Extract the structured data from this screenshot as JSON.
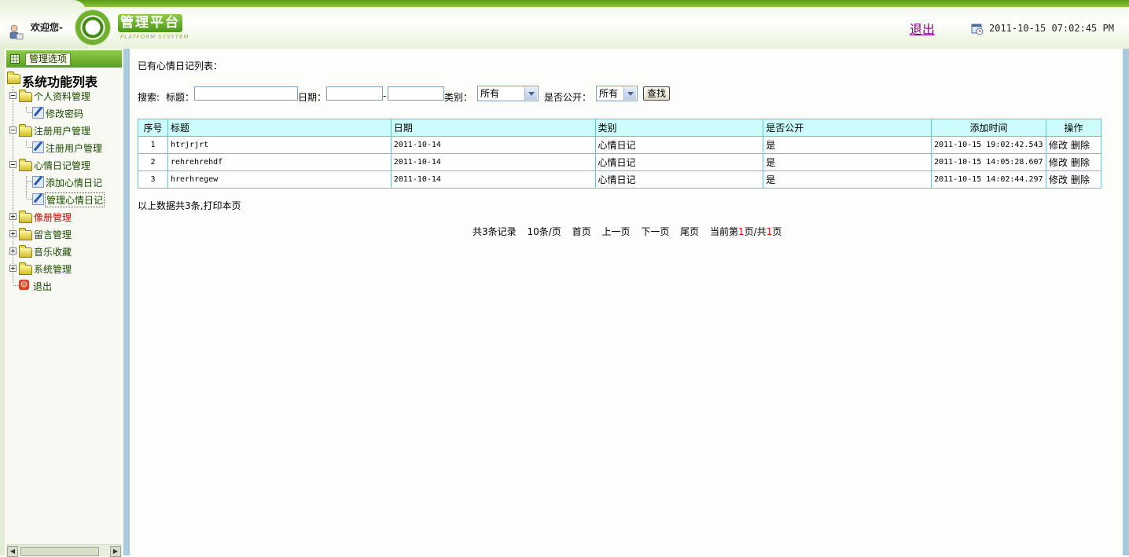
{
  "header": {
    "welcome": "欢迎您-",
    "logo_title": "管理平台",
    "logo_subtitle": "PLATFORM SYSYTEM",
    "logout": "退出",
    "datetime": "2011-10-15 07:02:45 PM"
  },
  "sidebar": {
    "options_button": "管理选项",
    "tree_title": "系统功能列表",
    "groups": [
      {
        "label": "个人资料管理",
        "expanded": true,
        "children": [
          "修改密码"
        ]
      },
      {
        "label": "注册用户管理",
        "expanded": true,
        "children": [
          "注册用户管理"
        ]
      },
      {
        "label": "心情日记管理",
        "expanded": true,
        "children": [
          "添加心情日记",
          "管理心情日记"
        ]
      },
      {
        "label": "像册管理",
        "expanded": false,
        "children": []
      },
      {
        "label": "留言管理",
        "expanded": false,
        "children": []
      },
      {
        "label": "音乐收藏",
        "expanded": false,
        "children": []
      },
      {
        "label": "系统管理",
        "expanded": false,
        "children": []
      }
    ],
    "exit": "退出",
    "hover_color": "#cc0000"
  },
  "main": {
    "list_heading": "已有心情日记列表：",
    "search": {
      "search_label": "搜索:",
      "title_label": "标题：",
      "title_value": "",
      "date_label": "日期：",
      "date_from": "",
      "date_sep": "-",
      "date_to": "",
      "category_label": "类别：",
      "category_value": "所有",
      "public_label": "是否公开：",
      "public_value": "所有",
      "button": "查找"
    },
    "table": {
      "headers": [
        "序号",
        "标题",
        "日期",
        "类别",
        "是否公开",
        "添加时间",
        "操作"
      ],
      "rows": [
        {
          "no": "1",
          "title": "htrjrjrt",
          "date": "2011-10-14",
          "category": "心情日记",
          "public": "是",
          "added": "2011-10-15 19:02:42.543",
          "edit": "修改",
          "delete": "删除"
        },
        {
          "no": "2",
          "title": "rehrehrehdf",
          "date": "2011-10-14",
          "category": "心情日记",
          "public": "是",
          "added": "2011-10-15 14:05:28.607",
          "edit": "修改",
          "delete": "删除"
        },
        {
          "no": "3",
          "title": "hrerhregew",
          "date": "2011-10-14",
          "category": "心情日记",
          "public": "是",
          "added": "2011-10-15 14:02:44.297",
          "edit": "修改",
          "delete": "删除"
        }
      ]
    },
    "summary": "以上数据共3条,打印本页",
    "pager": {
      "total": "共3条记录",
      "per_page": "10条/页",
      "first": "首页",
      "prev": "上一页",
      "next": "下一页",
      "last": "尾页",
      "current_prefix": "当前第",
      "current": "1",
      "mid": "页/共",
      "pages": "1",
      "suffix": "页"
    }
  },
  "colors": {
    "header_green": "#5a9a14",
    "table_border": "#5bc8d6",
    "table_header_bg": "#ccfcfc",
    "splitter": "#a9cbdd"
  }
}
